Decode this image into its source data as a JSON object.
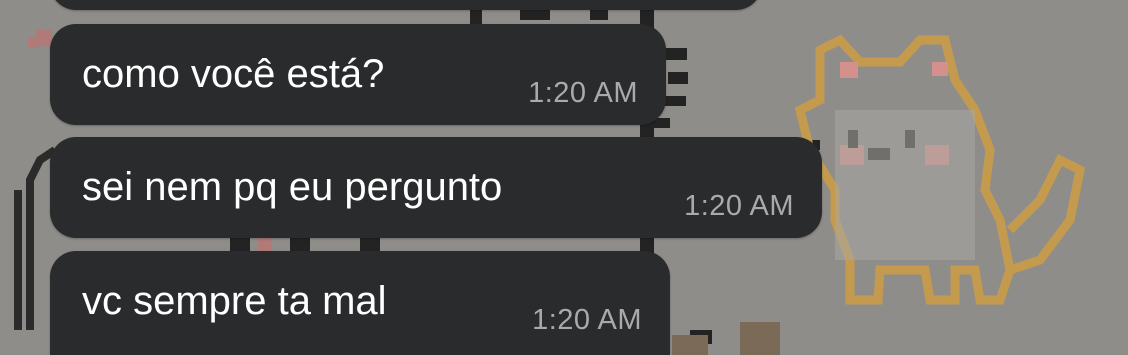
{
  "colors": {
    "wallpaper": "#8f8d89",
    "bubble": "#2a2b2c",
    "text": "#ffffff",
    "timestamp": "#a9aaab",
    "cat_outline": "#c49a4e",
    "cat_cheek": "#d3908c"
  },
  "messages": [
    {
      "text": "como você está?",
      "time": "1:20 AM"
    },
    {
      "text": "sei nem pq eu pergunto",
      "time": "1:20 AM"
    },
    {
      "text": "vc sempre ta mal",
      "time": "1:20 AM"
    }
  ]
}
